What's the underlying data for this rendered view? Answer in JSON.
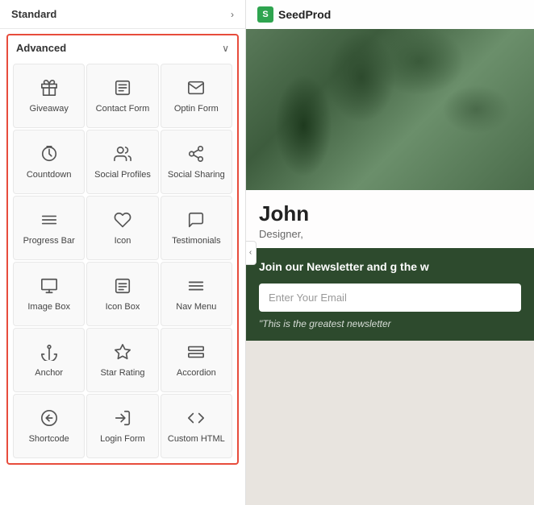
{
  "leftPanel": {
    "standard": {
      "label": "Standard",
      "chevron": "›"
    },
    "advanced": {
      "label": "Advanced",
      "chevron": "∨",
      "items": [
        {
          "id": "giveaway",
          "label": "Giveaway",
          "icon": "🎁",
          "iconType": "giveaway"
        },
        {
          "id": "contact-form",
          "label": "Contact Form",
          "icon": "📋",
          "iconType": "contact-form"
        },
        {
          "id": "optin-form",
          "label": "Optin Form",
          "icon": "✉",
          "iconType": "optin-form"
        },
        {
          "id": "countdown",
          "label": "Countdown",
          "icon": "⏱",
          "iconType": "countdown"
        },
        {
          "id": "social-profiles",
          "label": "Social Profiles",
          "icon": "👥",
          "iconType": "social-profiles"
        },
        {
          "id": "social-sharing",
          "label": "Social Sharing",
          "icon": "↗",
          "iconType": "social-sharing"
        },
        {
          "id": "progress-bar",
          "label": "Progress Bar",
          "icon": "≡",
          "iconType": "progress-bar"
        },
        {
          "id": "icon",
          "label": "Icon",
          "icon": "♡",
          "iconType": "icon"
        },
        {
          "id": "testimonials",
          "label": "Testimonials",
          "icon": "💬",
          "iconType": "testimonials"
        },
        {
          "id": "image-box",
          "label": "Image Box",
          "icon": "🖼",
          "iconType": "image-box"
        },
        {
          "id": "icon-box",
          "label": "Icon Box",
          "icon": "☐",
          "iconType": "icon-box"
        },
        {
          "id": "nav-menu",
          "label": "Nav Menu",
          "icon": "☰",
          "iconType": "nav-menu"
        },
        {
          "id": "anchor",
          "label": "Anchor",
          "icon": "⚓",
          "iconType": "anchor"
        },
        {
          "id": "star-rating",
          "label": "Star Rating",
          "icon": "☆",
          "iconType": "star-rating"
        },
        {
          "id": "accordion",
          "label": "Accordion",
          "icon": "▬",
          "iconType": "accordion"
        },
        {
          "id": "shortcode",
          "label": "Shortcode",
          "icon": "⊕",
          "iconType": "shortcode"
        },
        {
          "id": "login-form",
          "label": "Login Form",
          "icon": "↪",
          "iconType": "login-form"
        },
        {
          "id": "custom-html",
          "label": "Custom HTML",
          "icon": "<>",
          "iconType": "custom-html"
        }
      ]
    }
  },
  "rightPanel": {
    "header": {
      "logoLetter": "S",
      "brandName": "SeedProd"
    },
    "profile": {
      "name": "John",
      "title": "Designer,"
    },
    "newsletter": {
      "text": "Join our Newsletter and g the w",
      "inputPlaceholder": "Enter Your Email",
      "testimonial": "\"This is the greatest newsletter"
    },
    "collapseIcon": "‹"
  }
}
